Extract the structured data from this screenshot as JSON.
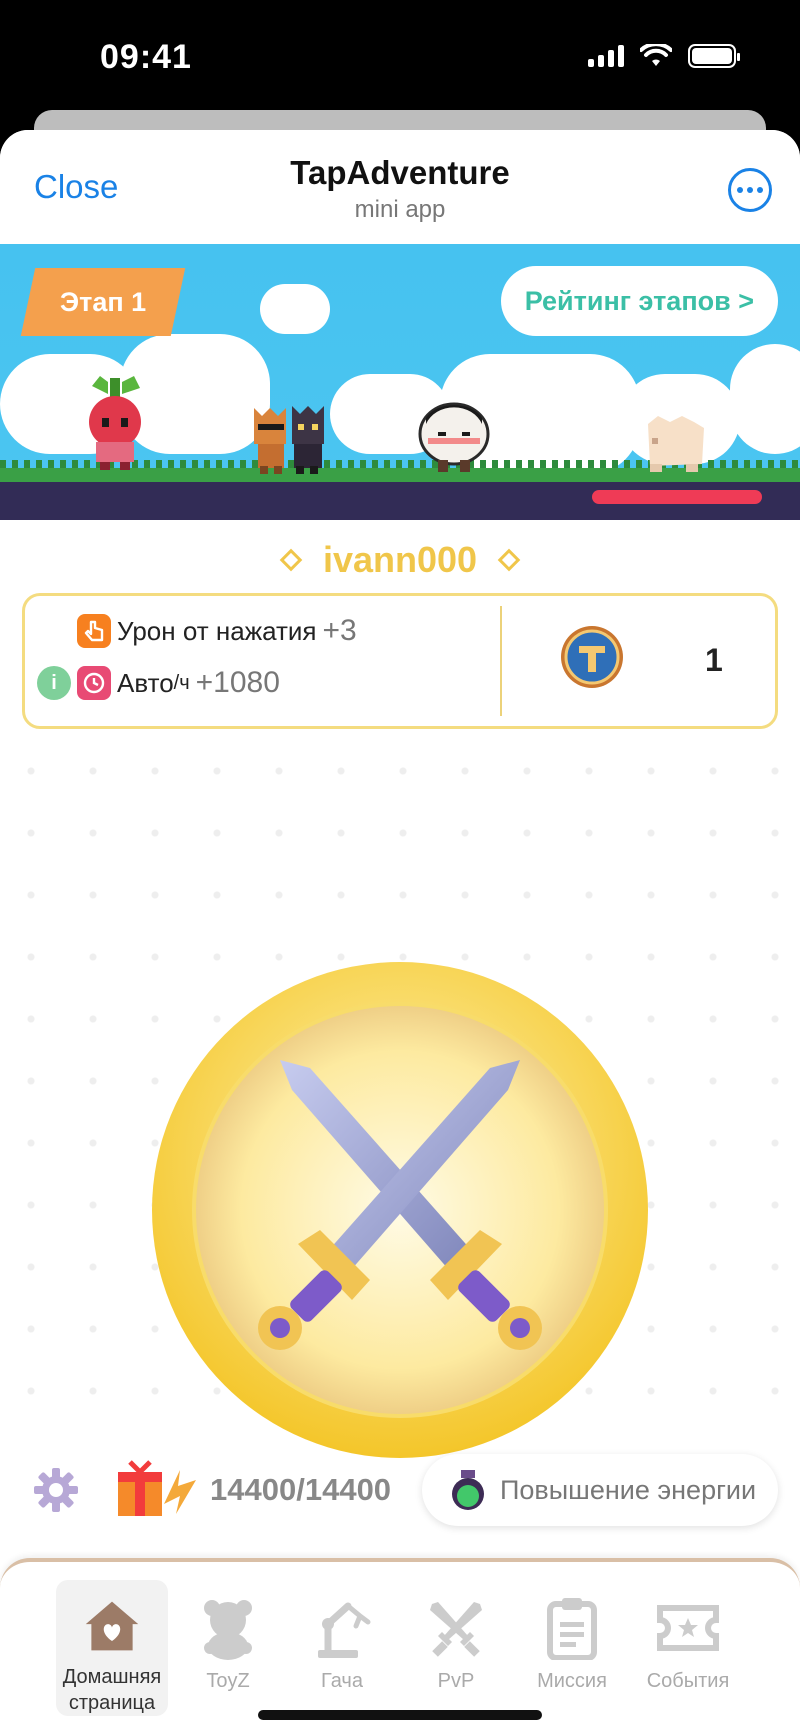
{
  "status_bar": {
    "time": "09:41"
  },
  "header": {
    "close_label": "Close",
    "title": "TapAdventure",
    "subtitle": "mini app",
    "more_icon": "more-dots-icon"
  },
  "banner": {
    "stage_label": "Этап 1",
    "rating_label": "Рейтинг этапов >",
    "enemy_hp_fraction": 1.0
  },
  "player": {
    "username": "ivann000"
  },
  "stats": {
    "tap_damage_label": "Урон от нажатия",
    "tap_damage_value": "+3",
    "auto_label": "Авто",
    "auto_unit": "/ч",
    "auto_value": "+1080",
    "info_label": "i",
    "coin_count": "1"
  },
  "energy": {
    "current": "14400",
    "separator": "/",
    "max": "14400",
    "boost_label": "Повышение энергии"
  },
  "nav": {
    "items": [
      {
        "label": "Домашняя страница",
        "icon": "home-icon",
        "active": true
      },
      {
        "label": "ToyZ",
        "icon": "teddy-bear-icon",
        "active": false
      },
      {
        "label": "Гача",
        "icon": "claw-machine-icon",
        "active": false
      },
      {
        "label": "PvP",
        "icon": "crossed-swords-icon",
        "active": false
      },
      {
        "label": "Миссия",
        "icon": "clipboard-icon",
        "active": false
      },
      {
        "label": "События",
        "icon": "ticket-icon",
        "active": false
      }
    ]
  },
  "colors": {
    "accent_blue": "#1a82e6",
    "gold": "#f0c64a",
    "stage_orange": "#f4a04d",
    "rating_teal": "#3bbfa6",
    "hp_red": "#ef3b56"
  }
}
